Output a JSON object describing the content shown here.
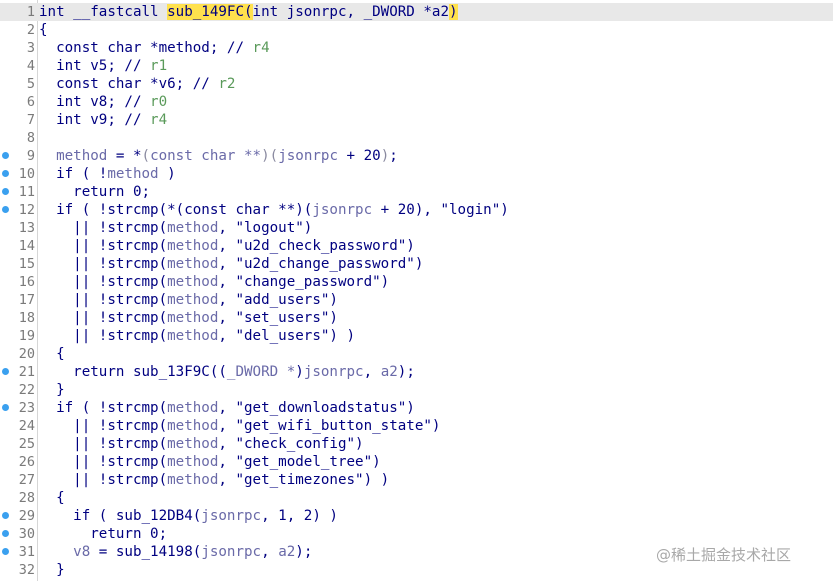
{
  "editor": {
    "lines": [
      {
        "n": "1",
        "bp": false,
        "current": true,
        "tokens": [
          [
            "t-kw",
            "int"
          ],
          [
            "t-plain",
            " __fastcall "
          ],
          [
            "t-hl",
            "sub_149FC"
          ],
          [
            "t-hl",
            "("
          ],
          [
            "t-plain",
            "int jsonrpc, _DWORD *a2"
          ],
          [
            "t-hl",
            ")"
          ]
        ]
      },
      {
        "n": "2",
        "bp": false,
        "current": false,
        "tokens": [
          [
            "t-punct",
            "{"
          ]
        ]
      },
      {
        "n": "3",
        "bp": false,
        "current": false,
        "tokens": [
          [
            "t-plain",
            "  const char *method; // "
          ],
          [
            "t-cmtreg",
            "r4"
          ]
        ]
      },
      {
        "n": "4",
        "bp": false,
        "current": false,
        "tokens": [
          [
            "t-plain",
            "  int v5; // "
          ],
          [
            "t-cmtreg",
            "r1"
          ]
        ]
      },
      {
        "n": "5",
        "bp": false,
        "current": false,
        "tokens": [
          [
            "t-plain",
            "  const char *v6; // "
          ],
          [
            "t-cmtreg",
            "r2"
          ]
        ]
      },
      {
        "n": "6",
        "bp": false,
        "current": false,
        "tokens": [
          [
            "t-plain",
            "  int v8; // "
          ],
          [
            "t-cmtreg",
            "r0"
          ]
        ]
      },
      {
        "n": "7",
        "bp": false,
        "current": false,
        "tokens": [
          [
            "t-plain",
            "  int v9; // "
          ],
          [
            "t-cmtreg",
            "r4"
          ]
        ]
      },
      {
        "n": "8",
        "bp": false,
        "current": false,
        "tokens": [
          [
            "t-plain",
            ""
          ]
        ]
      },
      {
        "n": "9",
        "bp": true,
        "current": false,
        "tokens": [
          [
            "t-plain",
            "  "
          ],
          [
            "t-var",
            "method"
          ],
          [
            "t-plain",
            " = *"
          ],
          [
            "t-gray",
            "("
          ],
          [
            "t-var",
            "const char **"
          ],
          [
            "t-gray",
            ")"
          ],
          [
            "t-gray",
            "("
          ],
          [
            "t-var",
            "jsonrpc"
          ],
          [
            "t-plain",
            " + 20"
          ],
          [
            "t-gray",
            ")"
          ],
          [
            "t-plain",
            ";"
          ]
        ]
      },
      {
        "n": "10",
        "bp": true,
        "current": false,
        "tokens": [
          [
            "t-plain",
            "  if ( !"
          ],
          [
            "t-var",
            "method"
          ],
          [
            "t-plain",
            " )"
          ]
        ]
      },
      {
        "n": "11",
        "bp": true,
        "current": false,
        "tokens": [
          [
            "t-plain",
            "    return 0;"
          ]
        ]
      },
      {
        "n": "12",
        "bp": true,
        "current": false,
        "tokens": [
          [
            "t-plain",
            "  if ( !strcmp(*(const char **)("
          ],
          [
            "t-var",
            "jsonrpc"
          ],
          [
            "t-plain",
            " + 20), \"login\")"
          ]
        ]
      },
      {
        "n": "13",
        "bp": false,
        "current": false,
        "tokens": [
          [
            "t-plain",
            "    || !strcmp("
          ],
          [
            "t-var",
            "method"
          ],
          [
            "t-plain",
            ", \"logout\")"
          ]
        ]
      },
      {
        "n": "14",
        "bp": false,
        "current": false,
        "tokens": [
          [
            "t-plain",
            "    || !strcmp("
          ],
          [
            "t-var",
            "method"
          ],
          [
            "t-plain",
            ", \"u2d_check_password\")"
          ]
        ]
      },
      {
        "n": "15",
        "bp": false,
        "current": false,
        "tokens": [
          [
            "t-plain",
            "    || !strcmp("
          ],
          [
            "t-var",
            "method"
          ],
          [
            "t-plain",
            ", \"u2d_change_password\")"
          ]
        ]
      },
      {
        "n": "16",
        "bp": false,
        "current": false,
        "tokens": [
          [
            "t-plain",
            "    || !strcmp("
          ],
          [
            "t-var",
            "method"
          ],
          [
            "t-plain",
            ", \"change_password\")"
          ]
        ]
      },
      {
        "n": "17",
        "bp": false,
        "current": false,
        "tokens": [
          [
            "t-plain",
            "    || !strcmp("
          ],
          [
            "t-var",
            "method"
          ],
          [
            "t-plain",
            ", \"add_users\")"
          ]
        ]
      },
      {
        "n": "18",
        "bp": false,
        "current": false,
        "tokens": [
          [
            "t-plain",
            "    || !strcmp("
          ],
          [
            "t-var",
            "method"
          ],
          [
            "t-plain",
            ", \"set_users\")"
          ]
        ]
      },
      {
        "n": "19",
        "bp": false,
        "current": false,
        "tokens": [
          [
            "t-plain",
            "    || !strcmp("
          ],
          [
            "t-var",
            "method"
          ],
          [
            "t-plain",
            ", \"del_users\") )"
          ]
        ]
      },
      {
        "n": "20",
        "bp": false,
        "current": false,
        "tokens": [
          [
            "t-plain",
            "  {"
          ]
        ]
      },
      {
        "n": "21",
        "bp": true,
        "current": false,
        "tokens": [
          [
            "t-plain",
            "    return sub_13F9C(("
          ],
          [
            "t-var",
            "_DWORD *"
          ],
          [
            "t-plain",
            ")"
          ],
          [
            "t-var",
            "jsonrpc"
          ],
          [
            "t-plain",
            ", "
          ],
          [
            "t-var",
            "a2"
          ],
          [
            "t-plain",
            ");"
          ]
        ]
      },
      {
        "n": "22",
        "bp": false,
        "current": false,
        "tokens": [
          [
            "t-plain",
            "  }"
          ]
        ]
      },
      {
        "n": "23",
        "bp": true,
        "current": false,
        "tokens": [
          [
            "t-plain",
            "  if ( !strcmp("
          ],
          [
            "t-var",
            "method"
          ],
          [
            "t-plain",
            ", \"get_downloadstatus\")"
          ]
        ]
      },
      {
        "n": "24",
        "bp": false,
        "current": false,
        "tokens": [
          [
            "t-plain",
            "    || !strcmp("
          ],
          [
            "t-var",
            "method"
          ],
          [
            "t-plain",
            ", \"get_wifi_button_state\")"
          ]
        ]
      },
      {
        "n": "25",
        "bp": false,
        "current": false,
        "tokens": [
          [
            "t-plain",
            "    || !strcmp("
          ],
          [
            "t-var",
            "method"
          ],
          [
            "t-plain",
            ", \"check_config\")"
          ]
        ]
      },
      {
        "n": "26",
        "bp": false,
        "current": false,
        "tokens": [
          [
            "t-plain",
            "    || !strcmp("
          ],
          [
            "t-var",
            "method"
          ],
          [
            "t-plain",
            ", \"get_model_tree\")"
          ]
        ]
      },
      {
        "n": "27",
        "bp": false,
        "current": false,
        "tokens": [
          [
            "t-plain",
            "    || !strcmp("
          ],
          [
            "t-var",
            "method"
          ],
          [
            "t-plain",
            ", \"get_timezones\") )"
          ]
        ]
      },
      {
        "n": "28",
        "bp": false,
        "current": false,
        "tokens": [
          [
            "t-plain",
            "  {"
          ]
        ]
      },
      {
        "n": "29",
        "bp": true,
        "current": false,
        "tokens": [
          [
            "t-plain",
            "    if ( sub_12DB4("
          ],
          [
            "t-var",
            "jsonrpc"
          ],
          [
            "t-plain",
            ", 1, 2) )"
          ]
        ]
      },
      {
        "n": "30",
        "bp": true,
        "current": false,
        "tokens": [
          [
            "t-plain",
            "      return 0;"
          ]
        ]
      },
      {
        "n": "31",
        "bp": true,
        "current": false,
        "tokens": [
          [
            "t-plain",
            "    "
          ],
          [
            "t-var",
            "v8"
          ],
          [
            "t-plain",
            " = sub_14198("
          ],
          [
            "t-var",
            "jsonrpc"
          ],
          [
            "t-plain",
            ", "
          ],
          [
            "t-var",
            "a2"
          ],
          [
            "t-plain",
            ");"
          ]
        ]
      },
      {
        "n": "32",
        "bp": false,
        "current": false,
        "tokens": [
          [
            "t-plain",
            "  }"
          ]
        ]
      }
    ]
  },
  "watermark": "@稀土掘金技术社区",
  "colors": {
    "highlight": "#ffe14d",
    "breakpoint": "#3aa0ef",
    "current_line": "#e8e8e8"
  }
}
